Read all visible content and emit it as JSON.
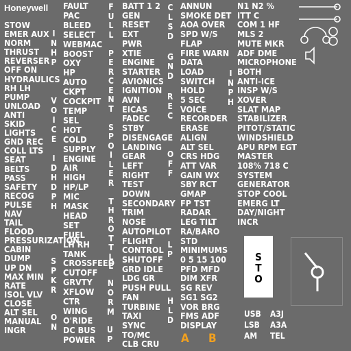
{
  "brand": "Honeywell",
  "col1": [
    "STOW",
    "EMER AUX",
    "NORM",
    "THRUST",
    "REVERSER",
    "OFF  ON",
    "HYDRAULICS",
    "RH LH",
    "PUMP",
    "UNLOAD",
    "ANTI",
    "SKID",
    "LIGHTS",
    "GND REC",
    "COLL LTS",
    "SEAT",
    "BELTS",
    "PASS",
    "SAFETY",
    "RECOG",
    "PULSE",
    "NAV",
    "TAIL",
    "FLOOD",
    "PRESSURIZATION",
    "CABIN",
    "DUMP",
    "UP  DN",
    "MAX MIN",
    "RATE",
    "ISOL  VLV",
    "CLOSE",
    "ALT SEL",
    "MANUAL",
    "INGR"
  ],
  "col2": [
    "FAULT",
    "PAC",
    "BLEED",
    "SELECT",
    "WEBMAC",
    "BOOST",
    "OXY",
    "HP",
    "AUTO",
    "CKPT",
    "COCKPIT",
    "TEMP",
    "SEL",
    "HOT",
    "COLD",
    "SUPPLY",
    "ENGINE",
    "AIR",
    "HIGH",
    "HP/LP",
    "MIC",
    "MASK",
    "HEAD",
    "SET",
    "FUEL",
    "LH RH",
    "TANK",
    "CROSSFEED",
    "CUTOFF",
    "GRVTY",
    "XFLOW",
    "CTR",
    "WING",
    "O'RIDE",
    "DC BUS",
    "POWER"
  ],
  "col3": [
    "BATT 1 2",
    "GEN",
    "RESET",
    "EXT",
    "PWR",
    "XTIE",
    "ENGINE",
    "STARTER",
    "AVIONICS",
    "IGNITION",
    "AVN",
    "EICAS",
    "FADEC",
    "STBY",
    "DISENGAGE",
    "LANDING",
    "GEAR",
    "LEFT",
    "RIGHT",
    "TEST",
    "DOWN",
    "SECONDARY",
    "TRIM",
    "NOSE",
    "AUTOPILOT",
    "FLIGHT",
    "CONTROL",
    "SHUTOFF",
    "GRD  IDLE",
    "LDG  GR",
    "PUSH  PULL",
    "FAN",
    "TURBINE",
    "TAXI",
    "SYNC",
    "TO/MC",
    "CLB  CRU"
  ],
  "col4": [
    "ANNUN",
    "SMOKE DET",
    "AOA  OVER",
    "SPD  W/S",
    "FLAP",
    "FIRE WARN",
    "DATA",
    "LOAD",
    "SWITCH",
    "HOLD",
    "5 SEC",
    "VOICE",
    "RECORDER",
    "ERASE",
    "ALIGN",
    "ALT SEL",
    "CRS  HDG",
    "ATT  VAR",
    "GAIN  WX",
    "SBY  RCT",
    "GMAP",
    "FP  TST",
    "RADAR",
    "LEG  TILT",
    "RA/BARO",
    "STD",
    "MINIMUMS",
    "0  5  15  100",
    "PFD  MFD",
    "DIM  XFR",
    "SG REV",
    "SG1  SG2",
    "VOR  BRG",
    "FMS  ADF",
    "DISPLAY"
  ],
  "col5": [
    "N1  N2  %",
    "ITT  C",
    "COM  1  HF",
    "MLS  2",
    "MUTE  MKR",
    "ADF  DME",
    "MICROPHONE",
    "BOTH",
    "ANTI-ICE",
    "INSP  W/S",
    "XOVER",
    "SLAT  MAP",
    "STABILIZER",
    "PITOT/STATIC",
    "WINDSHIELD",
    "APU  RPM  EGT",
    "MASTER",
    "108%  718  C",
    "SYSTEM",
    "GENERATOR",
    "STOP  COOL",
    "EMERG LT",
    "DAY/NIGHT",
    "INCR"
  ],
  "vertical": {
    "inhp": "INHP",
    "voice": "VOICE",
    "id": "ID",
    "hdph": "HDPH",
    "spkr": "SPKR",
    "on": "ON",
    "full_percent_spoiler_throttle": "FULL PERCENT SPOILER THROTTLE",
    "norm": "NORM",
    "up": "UP",
    "clsd": "CLSD",
    "gnd": "GND",
    "rec": "REC",
    "off": "OFF",
    "lp": "LP",
    "hld": "HLD",
    "inph": "INPH"
  },
  "orange_letters": [
    "A",
    "B"
  ],
  "sto_label": [
    "S",
    "T",
    "O"
  ],
  "bottom_tabs": [
    "USB",
    "A3J",
    "LSB",
    "A3A",
    "AM",
    "TEL"
  ],
  "colors": {
    "background": "#6b6b6b",
    "text": "#ffffff",
    "accent": "#f0a020"
  }
}
